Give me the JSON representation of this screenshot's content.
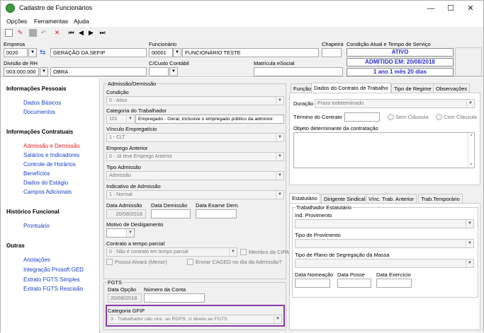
{
  "window": {
    "title": "Cadastro de Funcionários",
    "min": "—",
    "max": "☐",
    "close": "✕"
  },
  "menu": [
    "Opções",
    "Ferramentas",
    "Ajuda"
  ],
  "header": {
    "empresa_label": "Empresa",
    "empresa_code": "0020",
    "empresa_name": "GERAÇÃO DA SEFIP",
    "funcionario_label": "Funcionário",
    "funcionario_code": "00001",
    "funcionario_name": "FUNCIONÁRIO TESTE",
    "chapeira_label": "Chapeira",
    "chapeira_value": "",
    "condicao_label": "Condição Atual e Tempo de Serviço",
    "status_ativo": "ATIVO",
    "status_admitido": "ADMITIDO EM: 20/08/2018",
    "status_tempo": "1 ano 1 mês 20 dias",
    "divisao_label": "Divisão de RH",
    "divisao_code": "003.000.000",
    "divisao_name": "OBRA",
    "ccusto_label": "C/Custo Contábil",
    "ccusto_value": "",
    "matricula_label": "Matrícula eSocial",
    "matricula_value": ""
  },
  "sidebar": {
    "sections": [
      {
        "title": "Informações Pessoais",
        "items": [
          "Dados Básicos",
          "Documentos"
        ]
      },
      {
        "title": "Informações Contratuais",
        "items": [
          "Admissão e Demissão",
          "Salários e Indicadores",
          "Controle de Horários",
          "Benefícios",
          "Dados do Estágio",
          "Campos Adicionais"
        ]
      },
      {
        "title": "Histórico Funcional",
        "items": [
          "Prontuário"
        ]
      },
      {
        "title": "Outras",
        "items": [
          "Anotações",
          "Integração Prosoft GED",
          "Extrato FGTS Simples",
          "Extrato FGTS Rescisão"
        ]
      }
    ]
  },
  "admissao": {
    "group_title": "Admissão/Demissão",
    "condicao_label": "Condição",
    "condicao_value": "0 - Ativo",
    "categoria_label": "Categoria do Trabalhador",
    "categoria_code": "101",
    "categoria_desc": "Empregado - Geral, inclusive o empregado público da administ",
    "vinculo_label": "Vínculo Empregatício",
    "vinculo_value": "1 - CLT",
    "emprego_label": "Emprego Anterior",
    "emprego_value": "0 - Já teve Emprego Anterior",
    "tipo_label": "Tipo Admissão",
    "tipo_value": "Admissão",
    "indicativo_label": "Indicativo de Admissão",
    "indicativo_value": "1 - Normal",
    "data_adm_label": "Data Admissão",
    "data_adm_value": "20/08/2018",
    "data_dem_label": "Data Demissão",
    "data_dem_value": "",
    "data_exame_label": "Data Exame Dem.",
    "data_exame_value": "",
    "motivo_label": "Motivo de Desligamento",
    "contrato_label": "Contrato a tempo parcial",
    "contrato_value": "0 - Não é contrato em tempo parcial",
    "membro_cipa": "Membro da CIPA",
    "alvara": "Possui Alvará (Menor)",
    "caged": "Enviar CAGED no dia da Admissão?"
  },
  "fgts": {
    "group_title": "FGTS",
    "data_opcao_label": "Data Opção",
    "data_opcao_value": "20/08/2018",
    "numero_conta_label": "Número da Conta",
    "numero_conta_value": "",
    "categoria_label": "Categoria GFIP",
    "categoria_value": "3 - Trabalhador não vinc. ao RGPS, c/ direito ao FGTS",
    "highlight_color": "#8a3aa8"
  },
  "tabs_top": [
    "Função",
    "Dados do Contrato de Trabalho",
    "Tipo de Regime",
    "Observações"
  ],
  "contrato": {
    "duracao_label": "Duração",
    "duracao_value": "Prazo Indeterminado",
    "termino_label": "Término do Contrato",
    "sem_clausula": "Sem Cláusula",
    "com_clausula": "Com Cláusula",
    "objeto_label": "Objeto determinante da contratação"
  },
  "tabs_bottom": [
    "Estatutário",
    "Dirigente Sindical",
    "Vínc. Trab. Anterior",
    "Trab.Temporário"
  ],
  "estatutario": {
    "group_title": "Trabalhador Estatutário",
    "ind_label": "Ind. Provimento",
    "tipo_prov_label": "Tipo de Provimento",
    "plano_label": "Tipo de Plano de Segregação da Massa",
    "data_nomeacao": "Data Nomeação",
    "data_posse": "Data Posse",
    "data_exercicio": "Data Exercício"
  }
}
